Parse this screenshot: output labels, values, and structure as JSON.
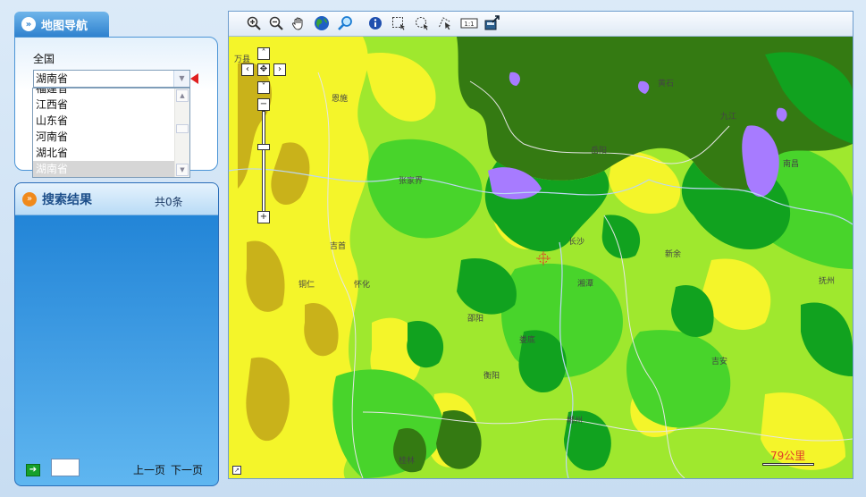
{
  "nav": {
    "title": "地图导航",
    "path": "全国",
    "selected_province": "湖南省",
    "options": [
      "福建省",
      "江西省",
      "山东省",
      "河南省",
      "湖北省",
      "湖南省"
    ]
  },
  "search": {
    "title": "搜索结果",
    "count": "共0条",
    "prev": "上一页",
    "next": "下一页"
  },
  "toolbar": {
    "tools": [
      "zoom-in-icon",
      "zoom-out-icon",
      "pan-hand-icon",
      "globe-icon",
      "search-magnifier-icon",
      "info-icon",
      "rect-select-icon",
      "circle-select-icon",
      "arrow-select-icon",
      "measure-icon",
      "export-icon"
    ]
  },
  "map": {
    "scale": "79公里",
    "labels": [
      "万县",
      "恩施",
      "张家界",
      "吉首",
      "怀化",
      "铜仁",
      "邵阳",
      "娄底",
      "长沙",
      "湘潭",
      "衡阳",
      "新余",
      "岳阳",
      "九江",
      "黄石",
      "南昌",
      "郴州",
      "桂林",
      "抚州",
      "吉安"
    ],
    "colors": {
      "yellow": "#f4f52a",
      "olive": "#c9b21a",
      "light_green": "#9fe82e",
      "green": "#48d42b",
      "dark_green": "#11a21f",
      "forest": "#347a12",
      "water": "#a77bff"
    }
  }
}
